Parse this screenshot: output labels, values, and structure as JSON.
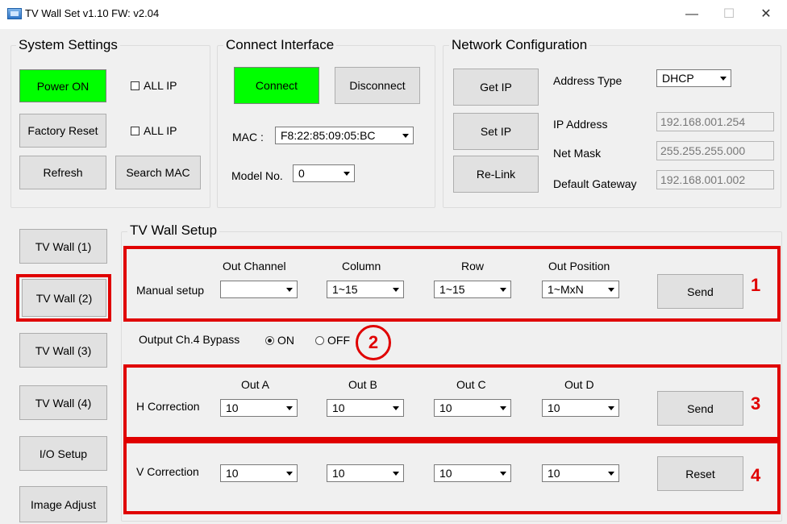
{
  "window": {
    "title": "TV Wall Set v1.10   FW: v2.04",
    "minimize_glyph": "—",
    "maximize_glyph": "☐",
    "close_glyph": "✕"
  },
  "system_settings": {
    "legend": "System Settings",
    "power_on": "Power ON",
    "factory_reset": "Factory Reset",
    "refresh": "Refresh",
    "all_ip_1": "ALL IP",
    "all_ip_2": "ALL IP",
    "search_mac": "Search MAC",
    "power_color": "#00ff00"
  },
  "connect_interface": {
    "legend": "Connect Interface",
    "connect": "Connect",
    "disconnect": "Disconnect",
    "mac_label": "MAC :",
    "mac_value": "F8:22:85:09:05:BC",
    "model_label": "Model No.",
    "model_value": "0"
  },
  "network": {
    "legend": "Network Configuration",
    "get_ip": "Get IP",
    "set_ip": "Set IP",
    "relink": "Re-Link",
    "address_type_label": "Address Type",
    "address_type_value": "DHCP",
    "ip_label": "IP Address",
    "ip_value": "192.168.001.254",
    "mask_label": "Net Mask",
    "mask_value": "255.255.255.000",
    "gateway_label": "Default Gateway",
    "gateway_value": "192.168.001.002"
  },
  "side_menu": [
    "TV Wall (1)",
    "TV Wall (2)",
    "TV Wall (3)",
    "TV Wall (4)",
    "I/O Setup",
    "Image Adjust"
  ],
  "setup": {
    "legend": "TV Wall Setup",
    "manual": {
      "label": "Manual setup",
      "headers": [
        "Out Channel",
        "Column",
        "Row",
        "Out Position"
      ],
      "values": [
        "",
        "1~15",
        "1~15",
        "1~MxN"
      ],
      "send": "Send"
    },
    "bypass": {
      "label": "Output Ch.4 Bypass",
      "on": "ON",
      "off": "OFF",
      "selected": "ON"
    },
    "h_correction": {
      "label": "H Correction",
      "headers": [
        "Out A",
        "Out B",
        "Out C",
        "Out D"
      ],
      "values": [
        "10",
        "10",
        "10",
        "10"
      ],
      "send": "Send"
    },
    "v_correction": {
      "label": "V Correction",
      "values": [
        "10",
        "10",
        "10",
        "10"
      ],
      "reset": "Reset"
    }
  },
  "annotations": {
    "marker_1": "1",
    "marker_2": "2",
    "marker_3": "3",
    "marker_4": "4",
    "highlight_color": "#e00000"
  }
}
